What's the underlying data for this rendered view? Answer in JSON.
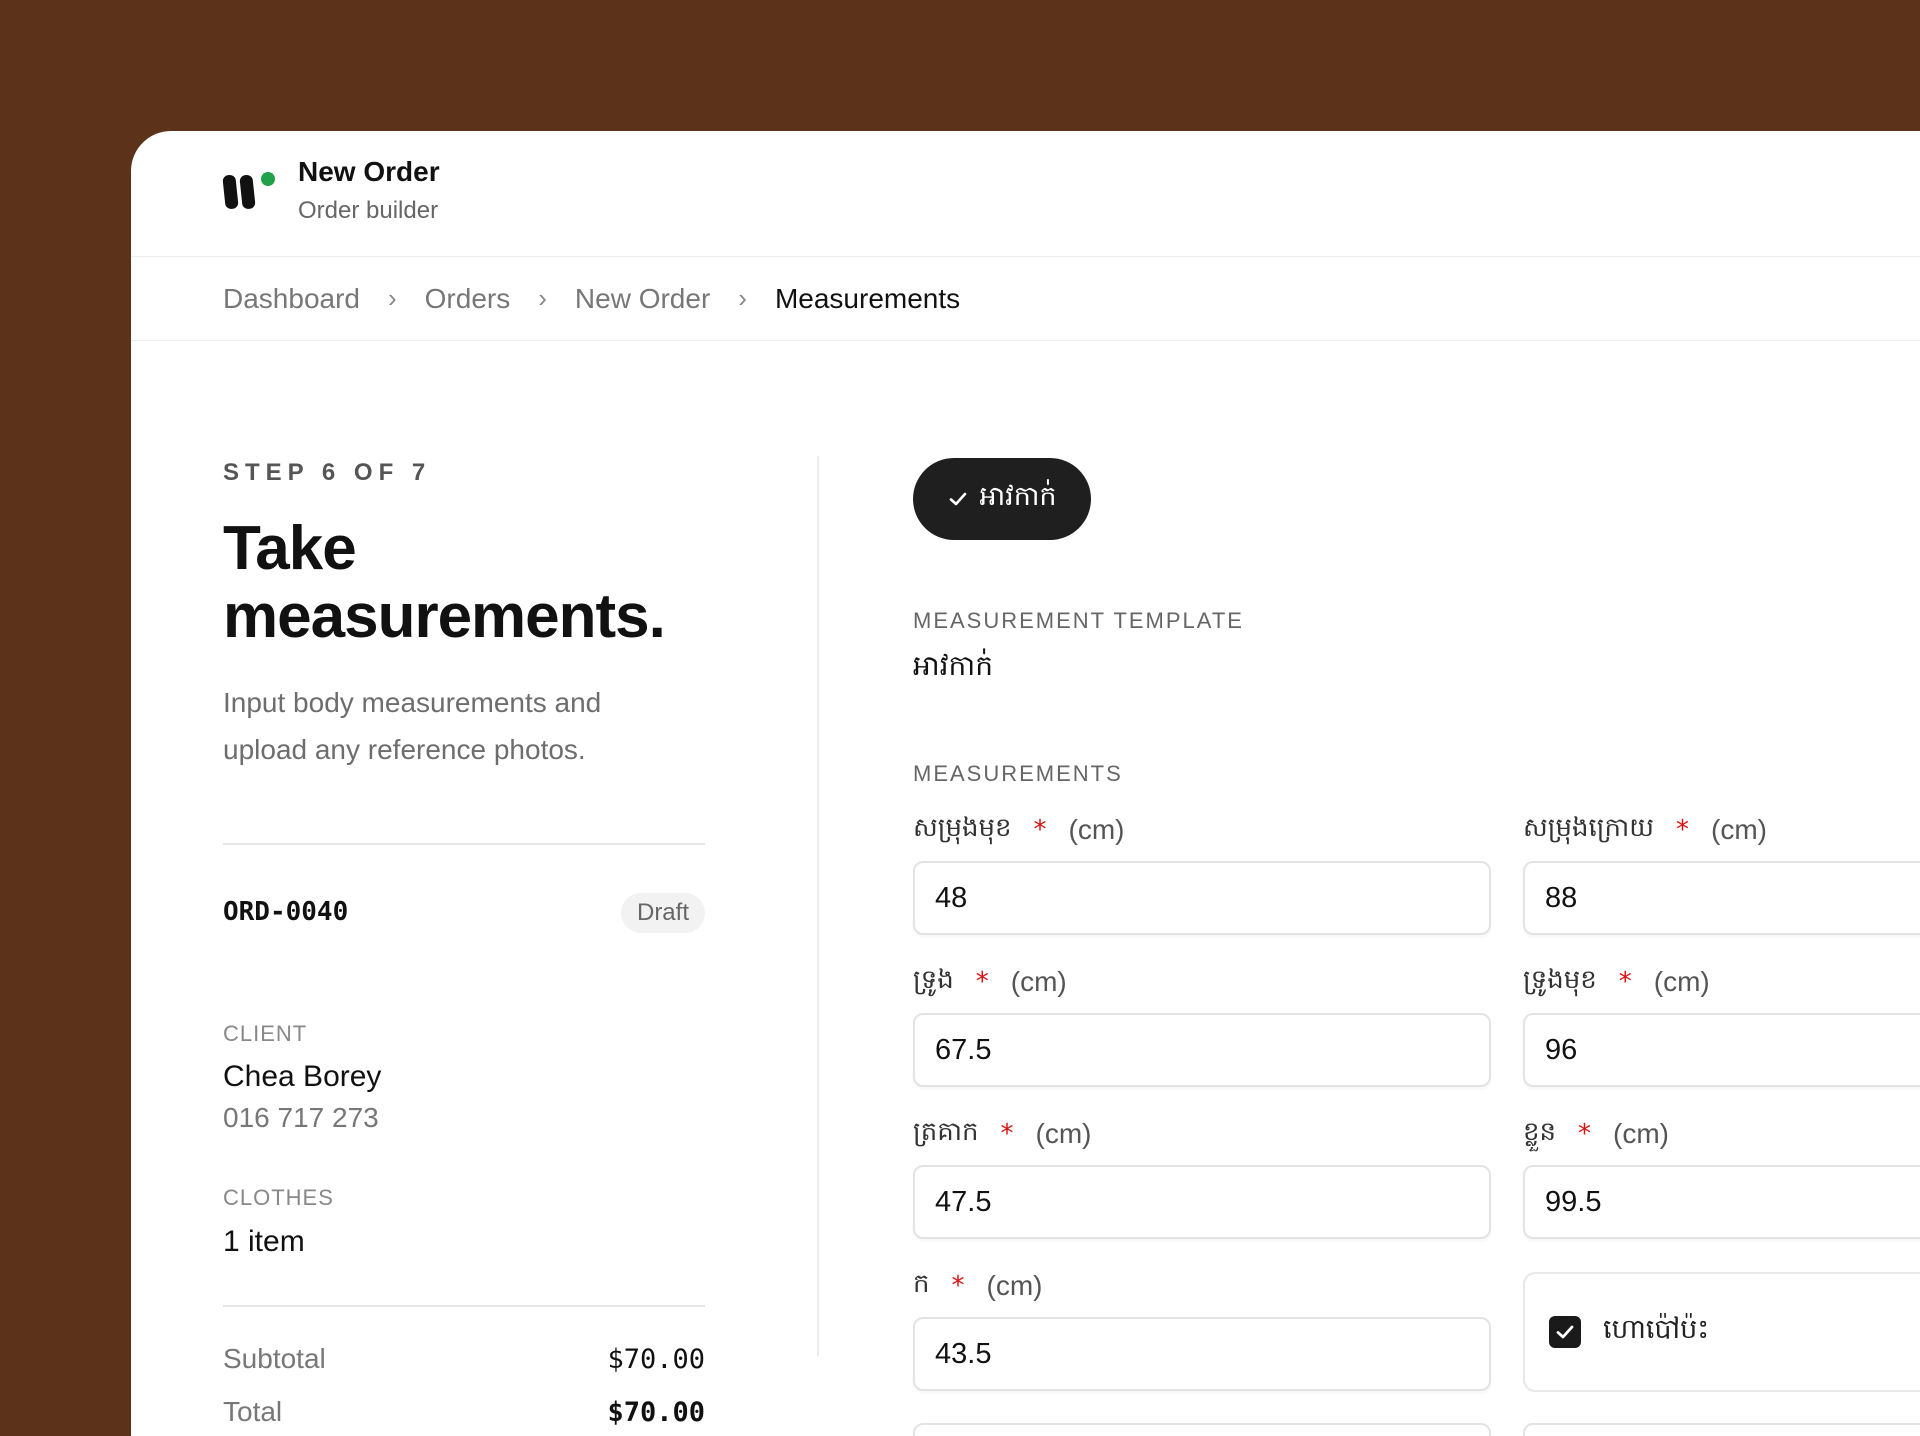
{
  "app": {
    "title": "New Order",
    "subtitle": "Order builder",
    "brand_dot_color": "#1fa24a"
  },
  "breadcrumb": {
    "items": [
      "Dashboard",
      "Orders",
      "New Order",
      "Measurements"
    ],
    "separator": "›"
  },
  "sidebar": {
    "step": "STEP 6 OF 7",
    "title_line1": "Take",
    "title_line2": "measurements.",
    "description": "Input body measurements and upload any reference photos.",
    "order_id": "ORD-0040",
    "status": "Draft",
    "client_label": "CLIENT",
    "client_name": "Chea Borey",
    "client_phone": "016 717 273",
    "clothes_label": "CLOTHES",
    "clothes_count": "1 item",
    "subtotal_label": "Subtotal",
    "subtotal_value": "$70.00",
    "total_label": "Total",
    "total_value": "$70.00"
  },
  "main": {
    "selected_chip": "អាវកាក់",
    "template_label": "MEASUREMENT TEMPLATE",
    "template_value": "អាវកាក់",
    "measurements_label": "MEASUREMENTS",
    "unit": "(cm)",
    "required_mark": "*",
    "fields": [
      {
        "label": "សម្រុងមុខ",
        "value": "48"
      },
      {
        "label": "សម្រុងក្រោយ",
        "value": "88"
      },
      {
        "label": "ទ្រូង",
        "value": "67.5"
      },
      {
        "label": "ទ្រូងមុខ",
        "value": "96"
      },
      {
        "label": "ត្រគាក",
        "value": "47.5"
      },
      {
        "label": "ខ្លួន",
        "value": "99.5"
      },
      {
        "label": "ក",
        "value": "43.5"
      }
    ],
    "checkbox": {
      "label": "ហោប៉ៅប៉ះ",
      "checked": true
    }
  }
}
